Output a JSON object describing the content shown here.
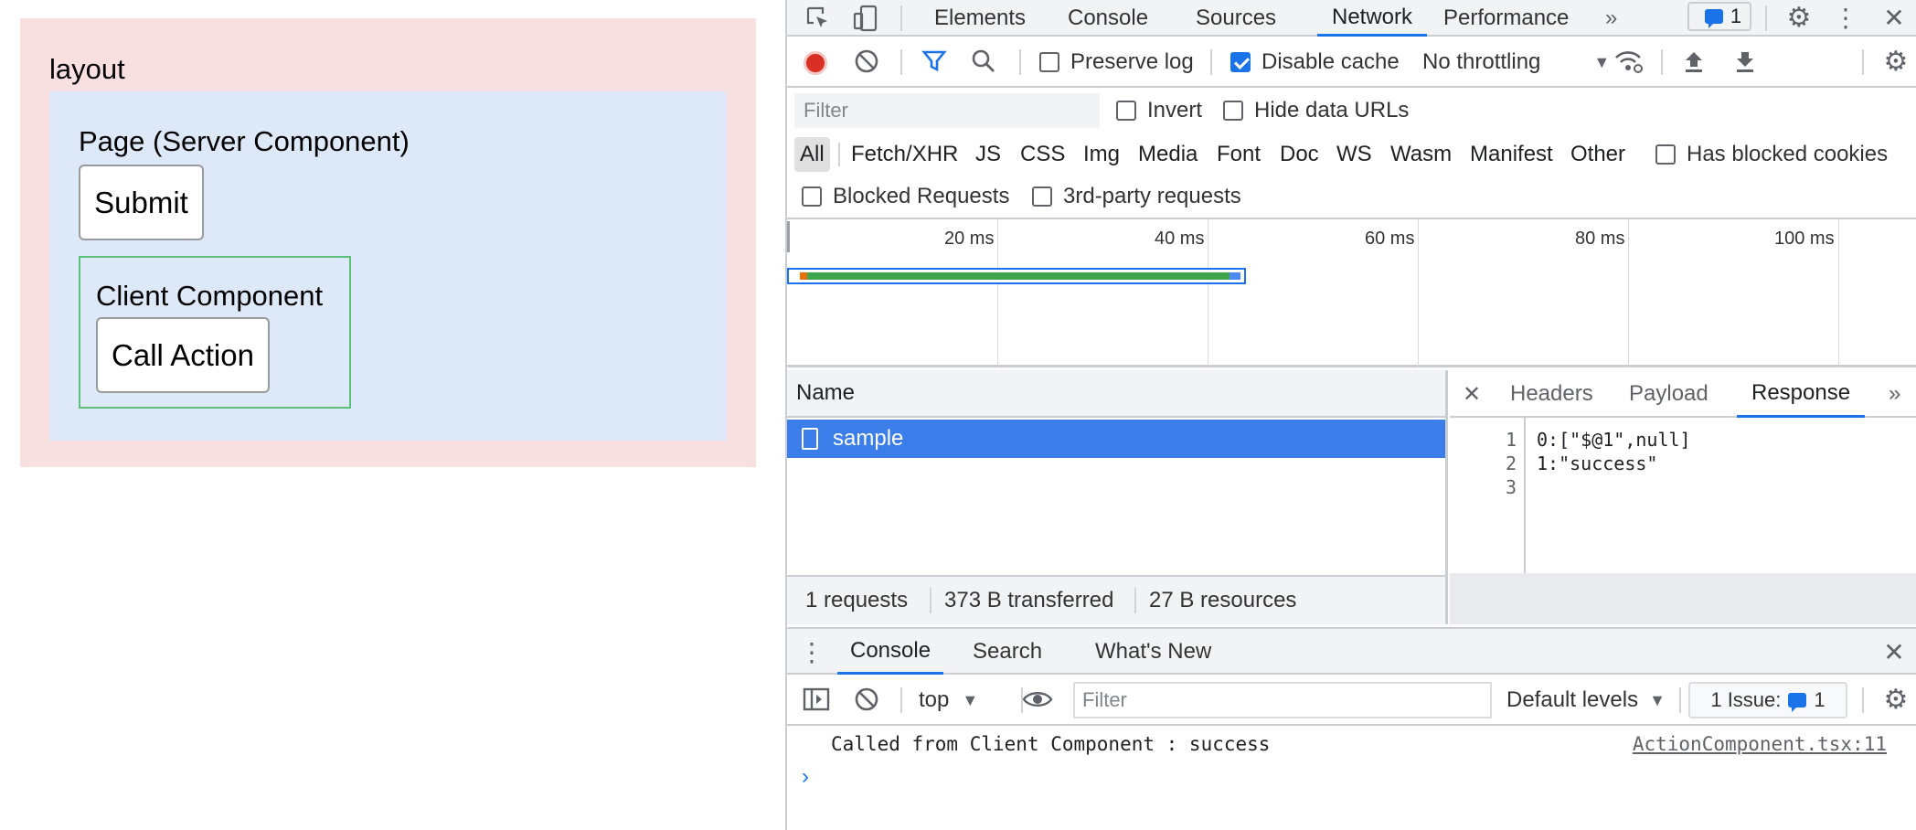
{
  "app": {
    "layout_label": "layout",
    "page_label": "Page (Server Component)",
    "submit_label": "Submit",
    "client_label": "Client Component",
    "call_action_label": "Call Action"
  },
  "devtools": {
    "tabs": [
      "Elements",
      "Console",
      "Sources",
      "Network",
      "Performance"
    ],
    "active_tab": "Network",
    "more_tabs_glyph": "»",
    "issues_count": "1",
    "toolbar": {
      "preserve_log": "Preserve log",
      "disable_cache": "Disable cache",
      "throttling": "No throttling"
    },
    "filter": {
      "placeholder": "Filter",
      "invert": "Invert",
      "hide_data_urls": "Hide data URLs"
    },
    "types": [
      "All",
      "Fetch/XHR",
      "JS",
      "CSS",
      "Img",
      "Media",
      "Font",
      "Doc",
      "WS",
      "Wasm",
      "Manifest",
      "Other"
    ],
    "has_blocked_cookies": "Has blocked cookies",
    "blocked_requests": "Blocked Requests",
    "third_party": "3rd-party requests",
    "timeline_ticks": [
      "20 ms",
      "40 ms",
      "60 ms",
      "80 ms",
      "100 ms"
    ],
    "requests": {
      "column_name": "Name",
      "rows": [
        "sample"
      ],
      "status": {
        "requests": "1 requests",
        "transferred": "373 B transferred",
        "resources": "27 B resources"
      }
    },
    "details": {
      "close_glyph": "✕",
      "tabs": [
        "Headers",
        "Payload",
        "Response"
      ],
      "active_tab": "Response",
      "more_glyph": "»",
      "lines": [
        {
          "n": "1",
          "text": "0:[\"$@1\",null]"
        },
        {
          "n": "2",
          "text": "1:\"success\""
        },
        {
          "n": "3",
          "text": ""
        }
      ]
    },
    "drawer": {
      "tabs": [
        "Console",
        "Search",
        "What's New"
      ],
      "active_tab": "Console",
      "context": "top",
      "filter_placeholder": "Filter",
      "levels": "Default levels",
      "issue_label": "1 Issue:",
      "issue_count": "1",
      "log": {
        "text": "Called from Client Component : success",
        "source": "ActionComponent.tsx:11"
      },
      "prompt_glyph": "›"
    }
  }
}
